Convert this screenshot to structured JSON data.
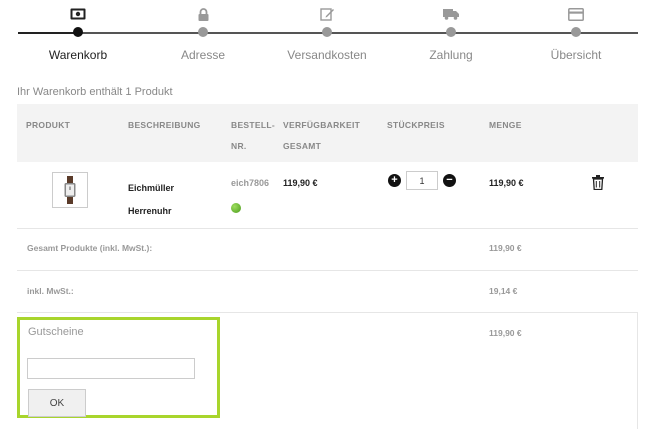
{
  "steps": [
    {
      "label": "Warenkorb",
      "icon": "banknote-icon",
      "active": true
    },
    {
      "label": "Adresse",
      "icon": "lock-icon",
      "active": false
    },
    {
      "label": "Versandkosten",
      "icon": "edit-icon",
      "active": false
    },
    {
      "label": "Zahlung",
      "icon": "truck-icon",
      "active": false
    },
    {
      "label": "Übersicht",
      "icon": "credit-card-icon",
      "active": false
    }
  ],
  "cart": {
    "summary": "Ihr Warenkorb enthält 1 Produkt",
    "headers": {
      "product": "PRODUKT",
      "description": "BESCHREIBUNG",
      "order_no_1": "BESTELL-",
      "order_no_2": "NR.",
      "availability_1": "VERFÜGBARKEIT",
      "availability_2": "GESAMT",
      "unit_price": "STÜCKPREIS",
      "quantity": "MENGE"
    },
    "item": {
      "name_1": "Eichmüller",
      "name_2": "Herrenuhr",
      "order_no": "eich7806",
      "total": "119,90 €",
      "quantity": "1",
      "unit_price": "119,90 €",
      "availability_color": "#5cb82a"
    },
    "totals": [
      {
        "label": "Gesamt Produkte (inkl. MwSt.):",
        "value": "119,90 €"
      },
      {
        "label": "inkl. MwSt.:",
        "value": "19,14 €"
      }
    ],
    "coupon": {
      "title": "Gutscheine",
      "input_value": "",
      "button": "OK",
      "value": "119,90 €",
      "highlight_color": "#a8d52c"
    }
  }
}
